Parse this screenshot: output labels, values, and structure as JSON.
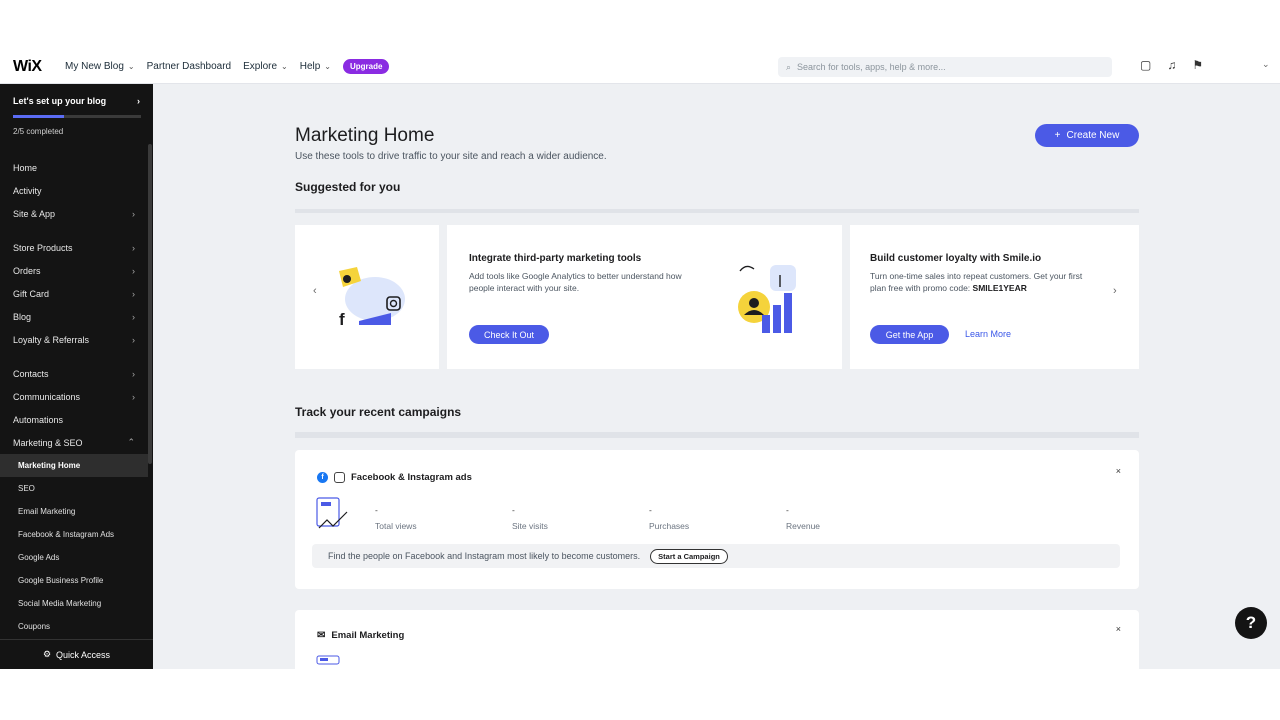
{
  "topbar": {
    "logo": "WiX",
    "site_name": "My New Blog",
    "nav": [
      "Partner Dashboard",
      "Explore",
      "Help"
    ],
    "upgrade": "Upgrade",
    "search_placeholder": "Search for tools, apps, help & more...",
    "icons": [
      "chat-icon",
      "bell-icon",
      "megaphone-icon"
    ]
  },
  "sidebar": {
    "setup_title": "Let's set up your blog",
    "setup_progress": 0.4,
    "setup_sub": "2/5 completed",
    "items": [
      {
        "label": "Home",
        "arrow": ""
      },
      {
        "label": "Activity",
        "arrow": ""
      },
      {
        "label": "Site & App",
        "arrow": "›"
      },
      {
        "label": "Store Products",
        "arrow": "›"
      },
      {
        "label": "Orders",
        "arrow": "›"
      },
      {
        "label": "Gift Card",
        "arrow": "›"
      },
      {
        "label": "Blog",
        "arrow": "›"
      },
      {
        "label": "Loyalty & Referrals",
        "arrow": "›"
      },
      {
        "label": "Contacts",
        "arrow": "›"
      },
      {
        "label": "Communications",
        "arrow": "›"
      },
      {
        "label": "Automations",
        "arrow": ""
      },
      {
        "label": "Marketing & SEO",
        "arrow": "⌃"
      }
    ],
    "subitems": [
      "Marketing Home",
      "SEO",
      "Email Marketing",
      "Facebook & Instagram Ads",
      "Google Ads",
      "Google Business Profile",
      "Social Media Marketing",
      "Coupons"
    ],
    "quick_access": "Quick Access"
  },
  "main": {
    "title": "Marketing Home",
    "subtitle": "Use these tools to drive traffic to your site and reach a wider audience.",
    "create_new": "Create New",
    "suggested_title": "Suggested for you",
    "card1": {
      "title": "Integrate third-party marketing tools",
      "desc": "Add tools like Google Analytics to better understand how people interact with your site.",
      "button": "Check It Out"
    },
    "card2": {
      "title": "Build customer loyalty with Smile.io",
      "desc": "Turn one-time sales into repeat customers. Get your first plan free with promo code:",
      "code": "SMILE1YEAR",
      "button": "Get the App",
      "link": "Learn More"
    },
    "track_title": "Track your recent campaigns",
    "fb": {
      "title": "Facebook & Instagram ads",
      "metrics": [
        "Total views",
        "Site visits",
        "Purchases",
        "Revenue"
      ],
      "dash": "-",
      "find_text": "Find the people on Facebook and Instagram most likely to become customers.",
      "button": "Start a Campaign"
    },
    "email": {
      "title": "Email Marketing"
    },
    "help": "?"
  }
}
